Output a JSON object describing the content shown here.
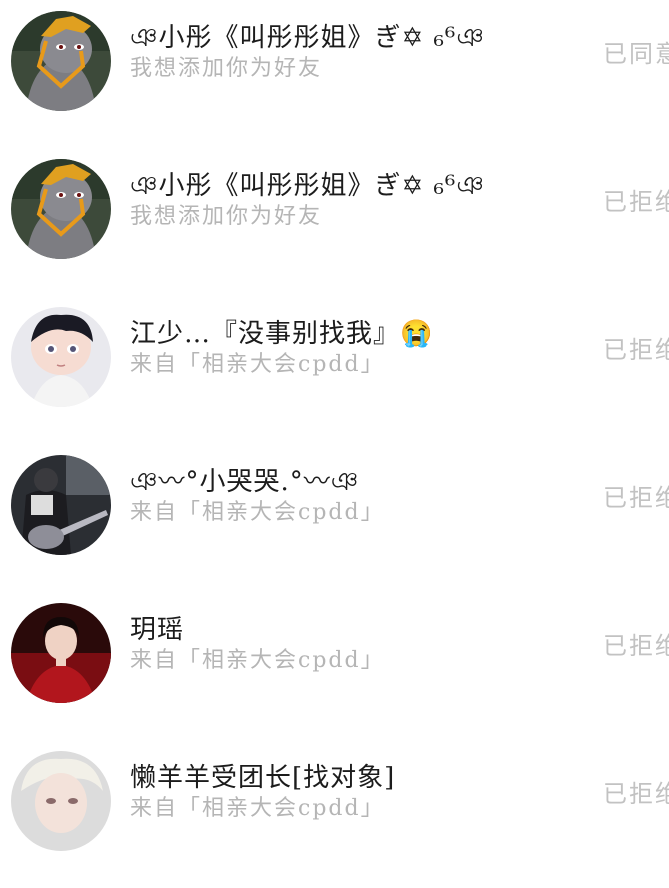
{
  "requests": [
    {
      "name": "ঞ小彤《叫彤彤姐》ぎ✡ ₆⁶ঞ",
      "message": "我想添加你为好友",
      "status": "已同意",
      "avatar_icon": "gray-cartoon-character-avatar"
    },
    {
      "name": "ঞ小彤《叫彤彤姐》ぎ✡ ₆⁶ঞ",
      "message": "我想添加你为好友",
      "status": "已拒绝",
      "avatar_icon": "gray-cartoon-character-avatar"
    },
    {
      "name": "江少…『没事别找我』😭",
      "message": "来自「相亲大会cpdd」",
      "status": "已拒绝",
      "avatar_icon": "anime-boy-avatar"
    },
    {
      "name": "ঞ〰°小哭哭.°〰ঞ",
      "message": "来自「相亲大会cpdd」",
      "status": "已拒绝",
      "avatar_icon": "guitar-player-avatar"
    },
    {
      "name": "玥瑶",
      "message": "来自「相亲大会cpdd」",
      "status": "已拒绝",
      "avatar_icon": "woman-red-dress-avatar"
    },
    {
      "name": "懒羊羊受团长[找对象]",
      "message": "来自「相亲大会cpdd」",
      "status": "已拒绝",
      "avatar_icon": "white-hair-person-avatar"
    }
  ]
}
